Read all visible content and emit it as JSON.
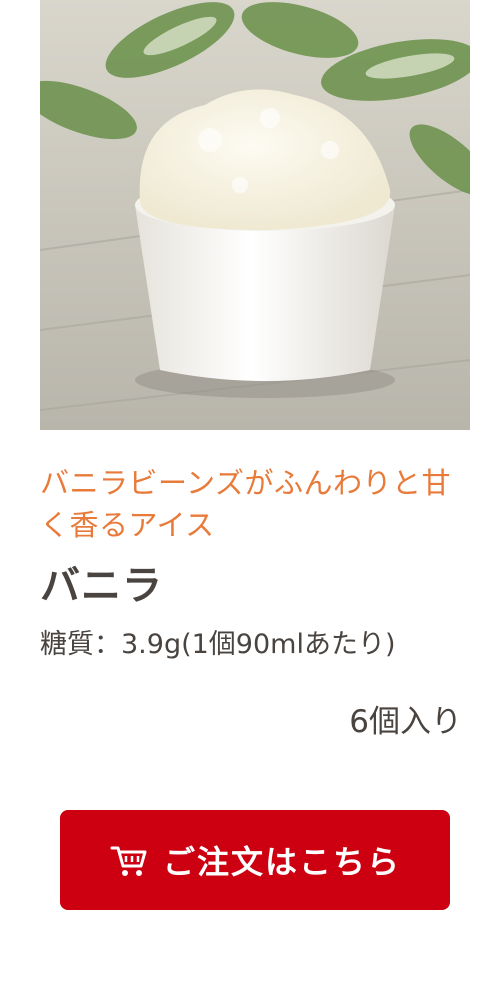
{
  "product": {
    "tagline": "バニラビーンズがふんわりと甘く香るアイス",
    "name": "バニラ",
    "carb_label": "糖質：3.9g(1個90mlあたり)",
    "quantity": "6個入り"
  },
  "order_button": {
    "label": "ご注文はこちら",
    "icon": "cart-icon"
  },
  "colors": {
    "accent": "#e87a3a",
    "button": "#cc0010",
    "text": "#4a4440"
  }
}
